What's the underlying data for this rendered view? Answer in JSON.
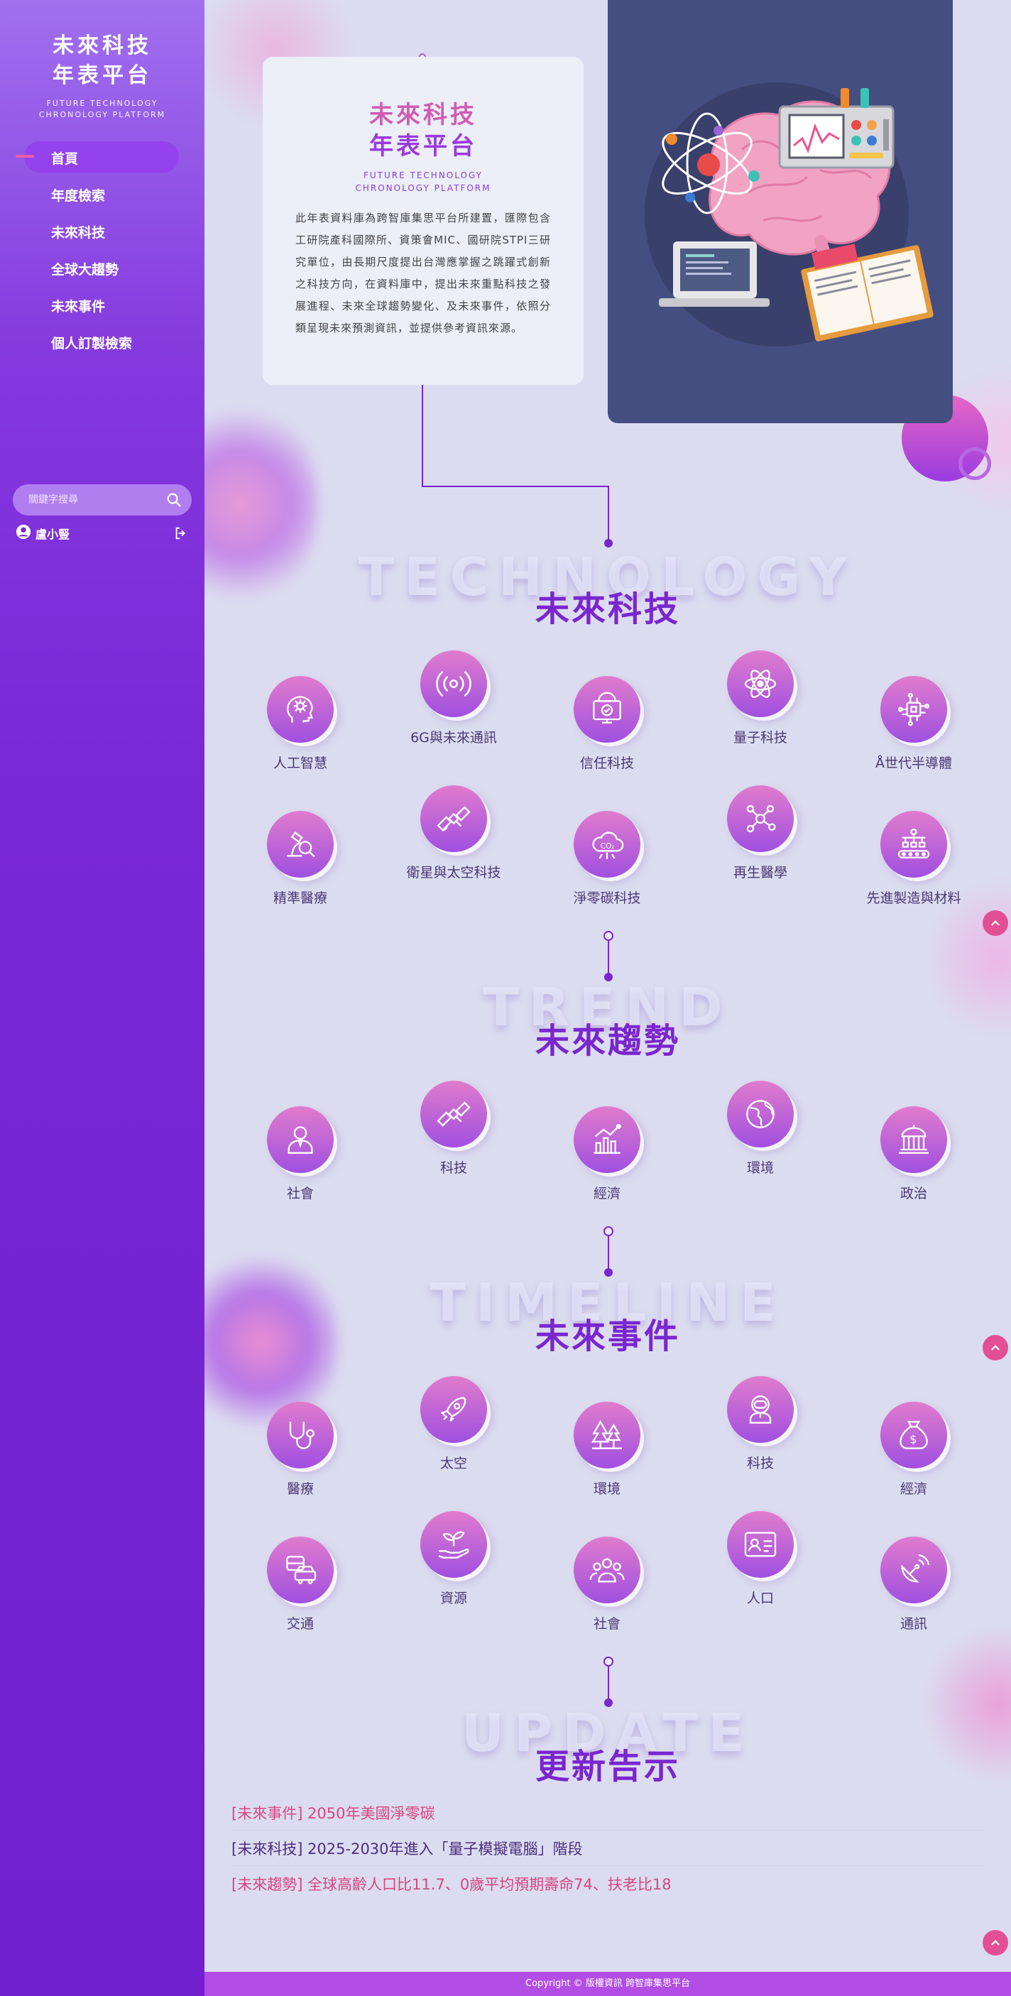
{
  "brand": {
    "title_line1": "未來科技",
    "title_line2": "年表平台",
    "sub_line1": "FUTURE TECHNOLOGY",
    "sub_line2": "CHRONOLOGY PLATFORM"
  },
  "nav": {
    "items": [
      {
        "label": "首頁",
        "active": true
      },
      {
        "label": "年度檢索"
      },
      {
        "label": "未來科技"
      },
      {
        "label": "全球大趨勢"
      },
      {
        "label": "未來事件"
      },
      {
        "label": "個人訂製檢索"
      }
    ]
  },
  "search": {
    "placeholder": "關鍵字搜尋"
  },
  "user": {
    "name": "盧小豎"
  },
  "intro": {
    "title_line1": "未來科技",
    "title_line2": "年表平台",
    "sub_line1": "FUTURE TECHNOLOGY",
    "sub_line2": "CHRONOLOGY PLATFORM",
    "body": "此年表資料庫為跨智庫集思平台所建置，匯際包含工研院產科國際所、資策會MIC、國研院STPI三研究單位，由長期尺度提出台灣應掌握之跳躍式創新之科技方向，在資料庫中，提出未來重點科技之發展進程、未來全球趨勢變化、及未來事件，依照分類呈現未來預測資訊，並提供參考資訊來源。"
  },
  "technology": {
    "bg_text": "TECHNOLOGY",
    "title": "未來科技",
    "items": [
      {
        "label": "人工智慧",
        "icon": "ai-head-icon"
      },
      {
        "label": "6G與未來通訊",
        "icon": "signal-icon"
      },
      {
        "label": "信任科技",
        "icon": "trust-screen-icon"
      },
      {
        "label": "量子科技",
        "icon": "atom-icon"
      },
      {
        "label": "Å世代半導體",
        "icon": "chip-icon"
      },
      {
        "label": "精準醫療",
        "icon": "microscope-icon"
      },
      {
        "label": "衛星與太空科技",
        "icon": "satellite-icon"
      },
      {
        "label": "淨零碳科技",
        "icon": "co2-cloud-icon"
      },
      {
        "label": "再生醫學",
        "icon": "molecule-icon"
      },
      {
        "label": "先進製造與材料",
        "icon": "conveyor-icon"
      }
    ]
  },
  "trend": {
    "bg_text": "TREND",
    "title": "未來趨勢",
    "items": [
      {
        "label": "社會",
        "icon": "person-icon"
      },
      {
        "label": "科技",
        "icon": "satellite-icon"
      },
      {
        "label": "經濟",
        "icon": "bar-chart-icon"
      },
      {
        "label": "環境",
        "icon": "globe-icon"
      },
      {
        "label": "政治",
        "icon": "government-building-icon"
      }
    ]
  },
  "timeline": {
    "bg_text": "TIMELINE",
    "title": "未來事件",
    "items": [
      {
        "label": "醫療",
        "icon": "stethoscope-icon"
      },
      {
        "label": "太空",
        "icon": "rocket-icon"
      },
      {
        "label": "環境",
        "icon": "trees-icon"
      },
      {
        "label": "科技",
        "icon": "robot-icon"
      },
      {
        "label": "經濟",
        "icon": "money-bag-icon"
      },
      {
        "label": "交通",
        "icon": "vehicles-icon"
      },
      {
        "label": "資源",
        "icon": "hand-plant-icon"
      },
      {
        "label": "社會",
        "icon": "group-icon"
      },
      {
        "label": "人口",
        "icon": "id-card-icon"
      },
      {
        "label": "通訊",
        "icon": "satellite-dish-icon"
      }
    ]
  },
  "update": {
    "bg_text": "UPDATE",
    "title": "更新告示",
    "items": [
      {
        "text": "[未來事件] 2050年美國淨零碳",
        "color": "#d8467f"
      },
      {
        "text": "[未來科技] 2025-2030年進入「量子模擬電腦」階段",
        "color": "#4a2e7e"
      },
      {
        "text": "[未來趨勢] 全球高齡人口比11.7、0歲平均預期壽命74、扶老比18",
        "color": "#d8467f"
      }
    ]
  },
  "footer": {
    "text": "Copyright © 版權資訊 跨智庫集思平台"
  },
  "colors": {
    "accent": "#7a26cf",
    "pink": "#e24f95",
    "sidebar": "#7020cf"
  }
}
